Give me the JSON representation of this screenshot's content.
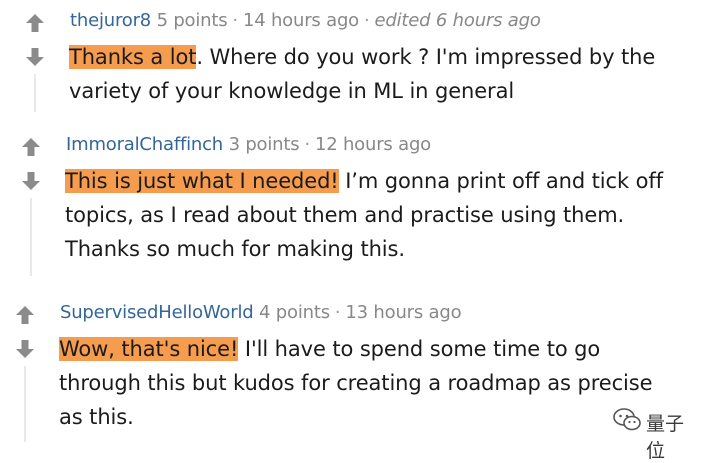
{
  "comments": [
    {
      "author": "thejuror8",
      "points": "5 points",
      "time": "14 hours ago",
      "edited": "edited 6 hours ago",
      "highlight": "Thanks a lot",
      "line1": ". Where do you work ? I'm impressed by the",
      "lines": [
        "variety of your knowledge in ML in general"
      ]
    },
    {
      "author": "ImmoralChaffinch",
      "points": "3 points",
      "time": "12 hours ago",
      "highlight": "This is just what I needed!",
      "line1": " I’m gonna print off and tick off",
      "lines": [
        "topics, as I read about them and practise using them.",
        "Thanks so much for making this."
      ]
    },
    {
      "author": "SupervisedHelloWorld",
      "points": "4 points",
      "time": "13 hours ago",
      "highlight": "Wow, that's nice!",
      "line1": " I'll have to spend some time to go",
      "lines": [
        "through this but kudos for creating a roadmap as precise",
        "as this."
      ]
    }
  ],
  "separator": "·",
  "watermark": {
    "text": "量子位",
    "icon": "wechat-icon"
  },
  "colors": {
    "author": "#336699",
    "highlight": "#f59c4f",
    "arrow": "#8b8b8b",
    "meta": "#888888"
  }
}
